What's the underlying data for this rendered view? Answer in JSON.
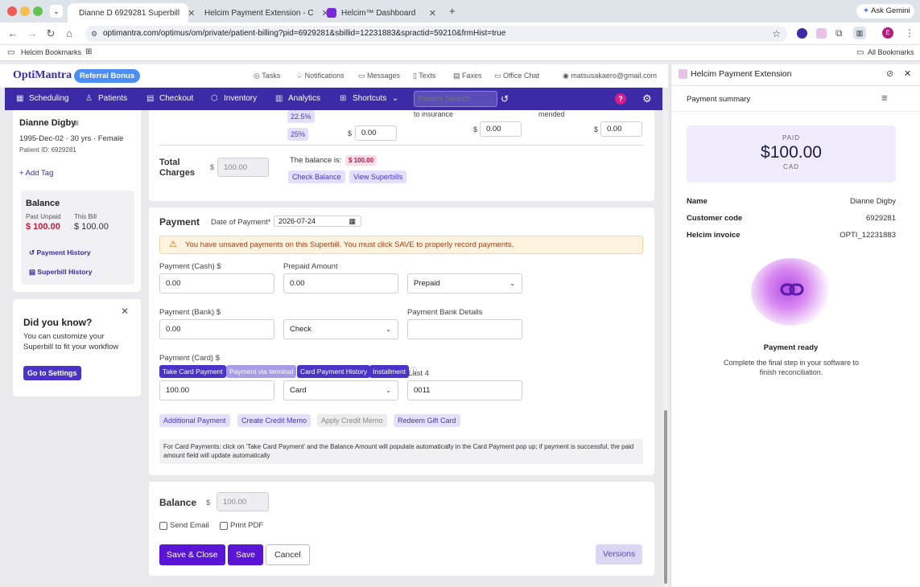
{
  "browser": {
    "tabs": [
      {
        "title": "Dianne D 6929281 Superbill",
        "active": true
      },
      {
        "title": "Helcim Payment Extension - C",
        "active": false
      },
      {
        "title": "Helcim™ Dashboard",
        "active": false
      }
    ],
    "ask_gemini": "Ask Gemini",
    "url": "optimantra.com/optimus/om/private/patient-billing?pid=6929281&sbillid=12231883&spractid=59210&frmHist=true",
    "bookmarks_label": "Helcim Bookmarks",
    "all_bookmarks": "All Bookmarks",
    "profile_initial": "E"
  },
  "app": {
    "logo": "OptiMantra",
    "referral": "Referral Bonus",
    "top_links": {
      "tasks": "Tasks",
      "notifications": "Notifications",
      "messages": "Messages",
      "texts": "Texts",
      "faxes": "Faxes",
      "office_chat": "Office Chat",
      "email": "matsusakaero@gmail.com"
    },
    "nav": {
      "scheduling": "Scheduling",
      "patients": "Patients",
      "checkout": "Checkout",
      "inventory": "Inventory",
      "analytics": "Analytics",
      "shortcuts": "Shortcuts",
      "search_placeholder": "Patient Search",
      "help": "?"
    },
    "patient": {
      "name": "Dianne Digby",
      "dob": "1995-Dec-02",
      "age": "30 yrs",
      "sex": "Female",
      "id_text": "Patient ID: 6929281",
      "add_tag": "+ Add Tag"
    },
    "balance_card": {
      "title": "Balance",
      "past_label": "Past Unpaid",
      "past_value": "$ 100.00",
      "this_label": "This Bill",
      "this_value": "$ 100.00",
      "payment_history": "Payment History",
      "superbill_history": "Superbill History"
    },
    "tip": {
      "title": "Did you know?",
      "text": "You can customize your Superbill to fit your workflow",
      "button": "Go to Settings"
    },
    "totals": {
      "pct1": "22.5%",
      "pct2": "25%",
      "partial_ins": "to insurance",
      "partial_amended": "mended",
      "amt1": "0.00",
      "amt2": "0.00",
      "amt3": "0.00",
      "dollar": "$",
      "total_label_1": "Total",
      "total_label_2": "Charges",
      "total_value": "100.00",
      "balance_is": "The balance is:",
      "balance_badge": "$ 100.00",
      "check_balance": "Check Balance",
      "view_superbills": "View Superbills"
    },
    "payment": {
      "title": "Payment",
      "date_label": "Date of Payment*",
      "date_value": "2026-07-24",
      "warning": "You have unsaved payments on this Superbill. You must click SAVE to properly record payments.",
      "cash_label": "Payment (Cash) $",
      "cash_value": "0.00",
      "prepaid_label": "Prepaid Amount",
      "prepaid_value": "0.00",
      "prepaid_select": "Prepaid",
      "bank_label": "Payment (Bank) $",
      "bank_value": "0.00",
      "bank_select": "Check",
      "bank_details_label": "Payment Bank Details",
      "bank_details_value": "",
      "card_label": "Payment (Card) $",
      "take_card": "Take Card Payment",
      "via_terminal": "Payment via terminal",
      "card_history": "Card Payment History",
      "installment": "Installment",
      "last4_label": "Last 4",
      "card_value": "100.00",
      "card_select": "Card",
      "last4_value": "0011",
      "additional": "Additional Payment",
      "create_credit": "Create Credit Memo",
      "apply_credit": "Apply Credit Memo",
      "redeem_gift": "Redeem Gift Card",
      "note": "For Card Payments: click on 'Take Card Payment' and the Balance Amount will populate automatically in the Card Payment pop up; if payment is successful, the paid amount field will update automatically"
    },
    "footer": {
      "balance_label": "Balance",
      "dollar": "$",
      "balance_value": "100.00",
      "send_email": "Send Email",
      "print_pdf": "Print PDF",
      "save_close": "Save & Close",
      "save": "Save",
      "cancel": "Cancel",
      "versions": "Versions"
    }
  },
  "extension": {
    "title": "Helcim Payment Extension",
    "summary": "Payment summary",
    "status": "PAID",
    "amount": "$100.00",
    "currency": "CAD",
    "rows": [
      {
        "label": "Name",
        "value": "Dianne Digby"
      },
      {
        "label": "Customer code",
        "value": "6929281"
      },
      {
        "label": "Helcim invoice",
        "value": "OPTI_12231883"
      }
    ],
    "ready_title": "Payment ready",
    "ready_text": "Complete the final step in your software to finish reconciliation.",
    "colors": {
      "accent": "#4b33c9",
      "paid_bg": "#f1ecfd"
    }
  }
}
